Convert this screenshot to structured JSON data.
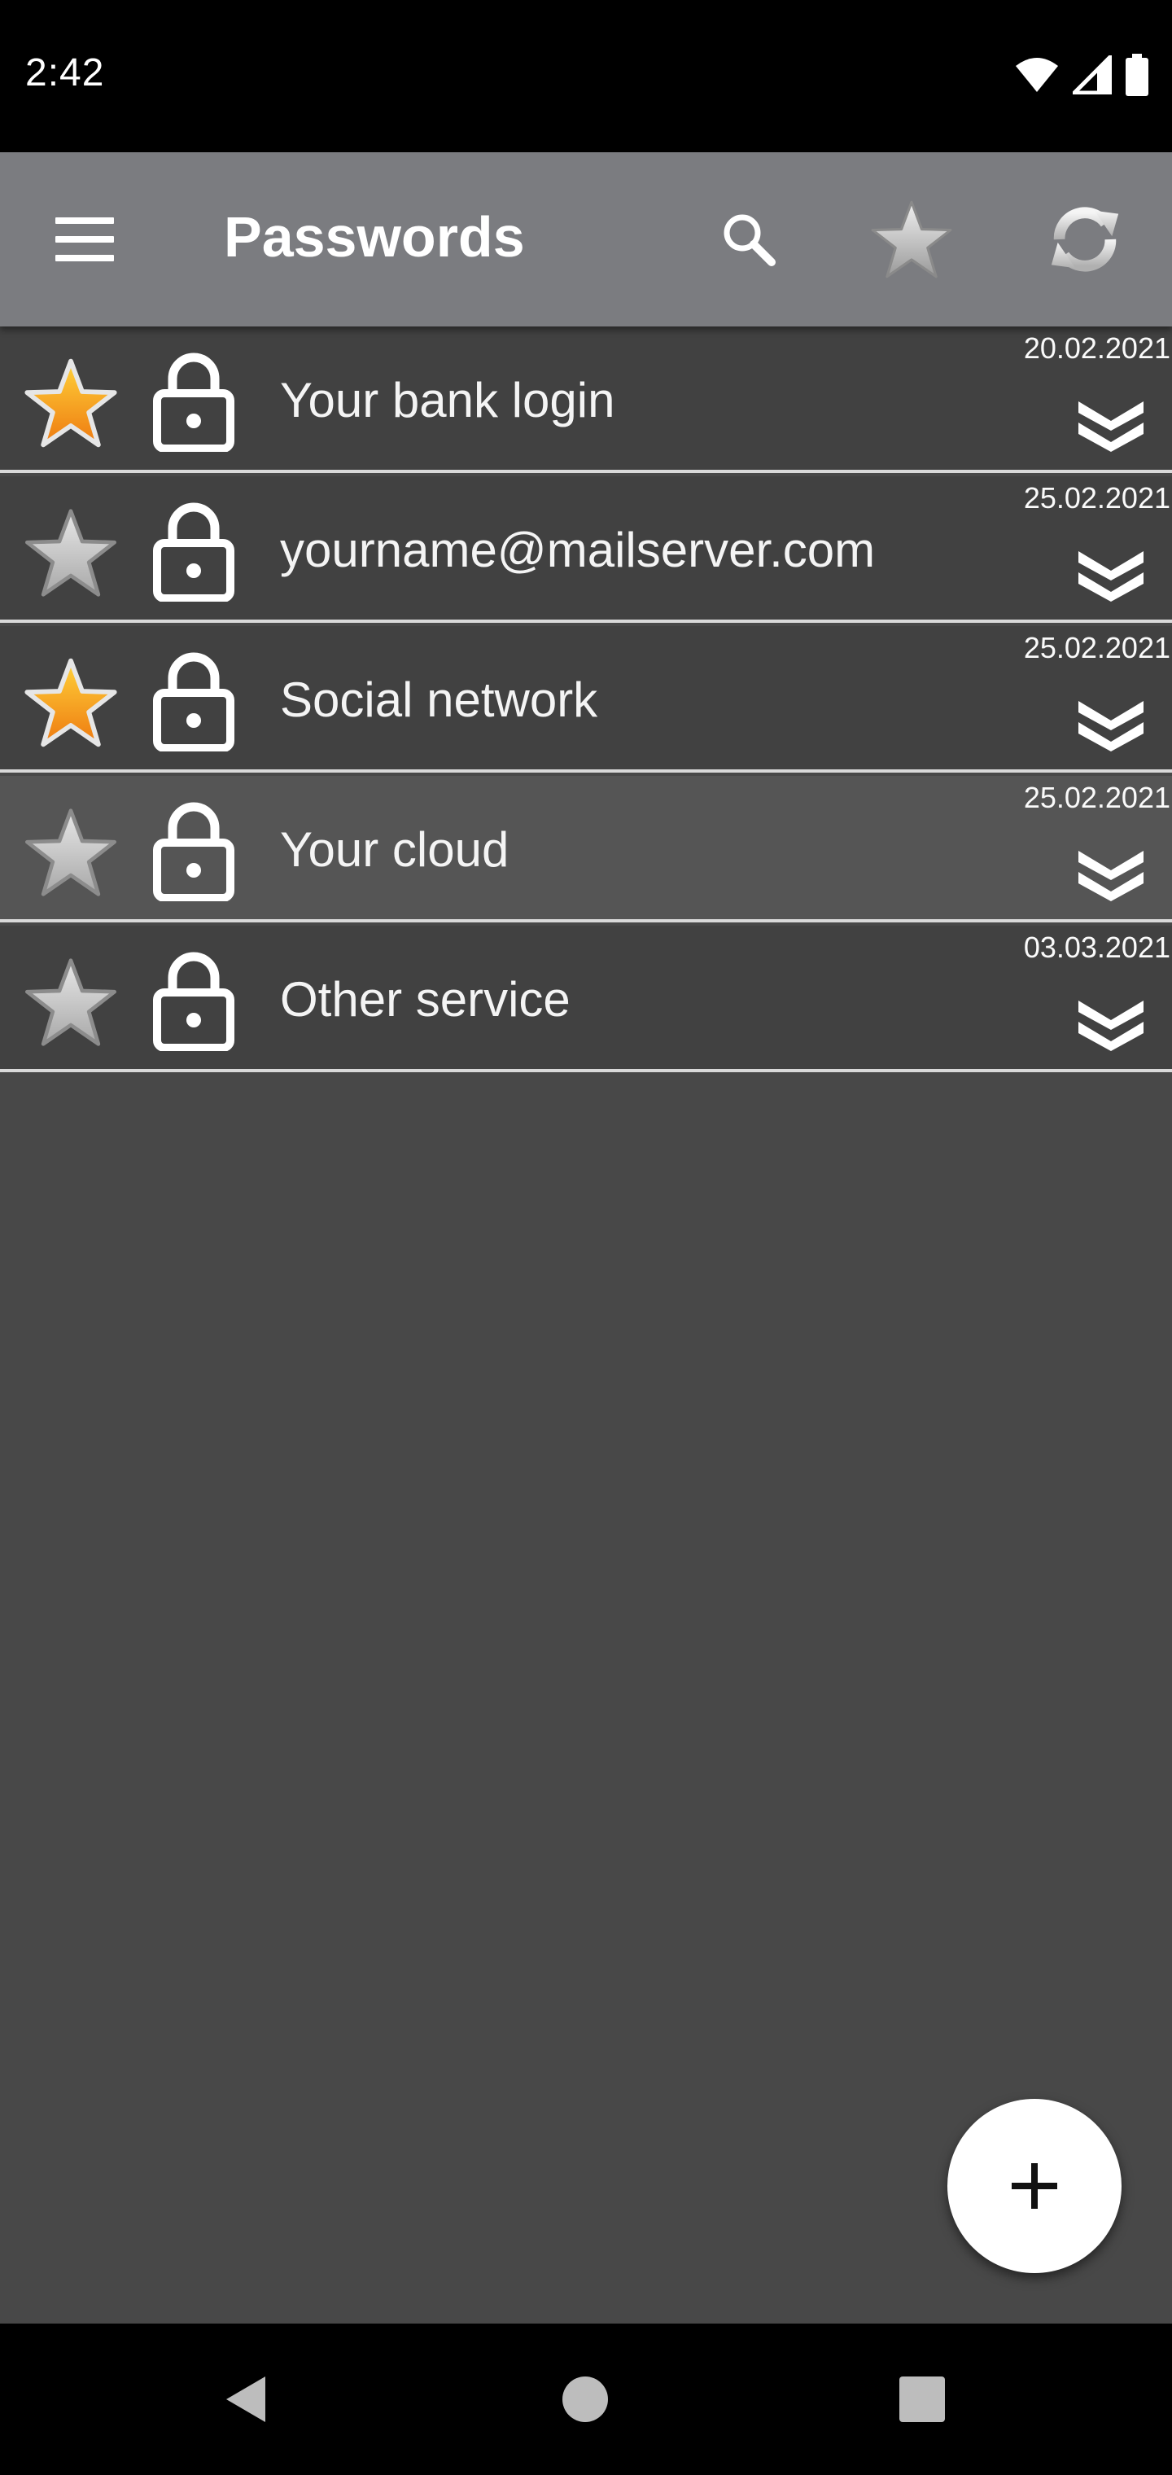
{
  "status_bar": {
    "time": "2:42",
    "icons": [
      "wifi-icon",
      "signal-icon",
      "battery-icon"
    ]
  },
  "app_bar": {
    "title": "Passwords",
    "background_color": "#7b7c80",
    "actions": [
      "menu-icon",
      "search-icon",
      "favorites-star-icon",
      "sync-icon"
    ]
  },
  "entries": [
    {
      "name": "Your bank login",
      "date": "20.02.2021",
      "favorite": true
    },
    {
      "name": "yourname@mailserver.com",
      "date": "25.02.2021",
      "favorite": false
    },
    {
      "name": "Social network",
      "date": "25.02.2021",
      "favorite": true
    },
    {
      "name": "Your cloud",
      "date": "25.02.2021",
      "favorite": false,
      "selected": true
    },
    {
      "name": "Other service",
      "date": "03.03.2021",
      "favorite": false
    }
  ],
  "colors": {
    "list_background": "#484848",
    "row_background": "#414141",
    "row_selected": "#555555",
    "favorite_star": "#f39a1c",
    "inactive_star": "#c8c8c8"
  },
  "fab": {
    "icon": "plus-icon"
  },
  "nav_bar": {
    "buttons": [
      "back-icon",
      "home-icon",
      "recents-icon"
    ]
  }
}
